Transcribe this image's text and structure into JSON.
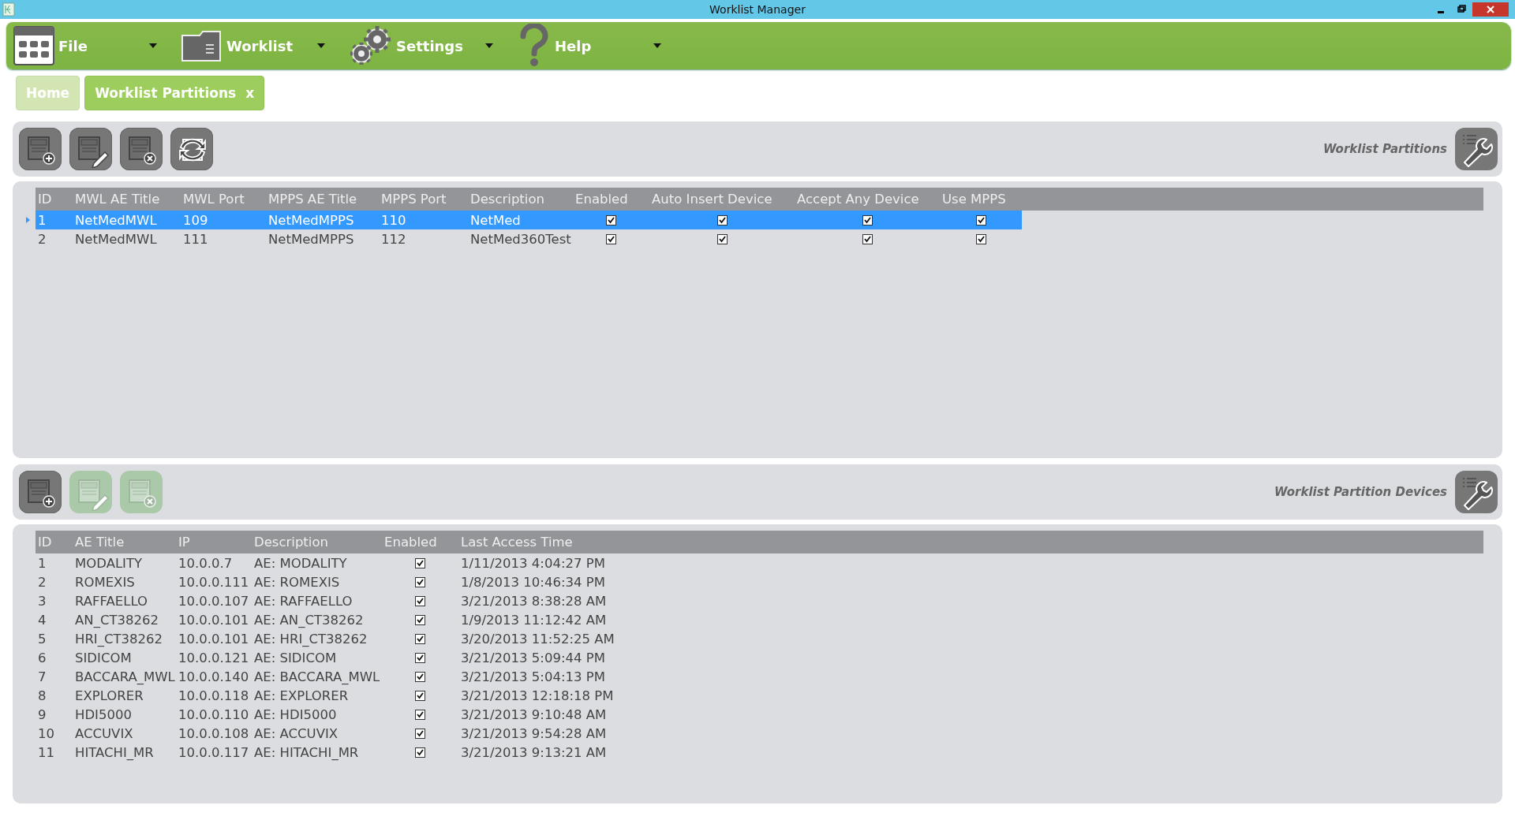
{
  "window": {
    "title": "Worklist Manager"
  },
  "menu": [
    {
      "label": "File",
      "kind": "file"
    },
    {
      "label": "Worklist",
      "kind": "worklist"
    },
    {
      "label": "Settings",
      "kind": "settings"
    },
    {
      "label": "Help",
      "kind": "help"
    }
  ],
  "tabs": [
    {
      "label": "Home",
      "selected": false
    },
    {
      "label": "Worklist Partitions",
      "selected": true,
      "close_label": "x"
    }
  ],
  "sections": [
    {
      "title": "Worklist Partitions",
      "toolbar": [
        {
          "kind": "add",
          "disabled": false
        },
        {
          "kind": "edit",
          "disabled": false
        },
        {
          "kind": "delete",
          "disabled": false
        },
        {
          "kind": "refresh",
          "disabled": false
        }
      ],
      "columns": [
        {
          "label": "ID",
          "kind": "text"
        },
        {
          "label": "MWL AE Title",
          "kind": "text"
        },
        {
          "label": "MWL Port",
          "kind": "text"
        },
        {
          "label": "MPPS AE Title",
          "kind": "text"
        },
        {
          "label": "MPPS Port",
          "kind": "text"
        },
        {
          "label": "Description",
          "kind": "text"
        },
        {
          "label": "Enabled",
          "kind": "check"
        },
        {
          "label": "Auto Insert Device",
          "kind": "check"
        },
        {
          "label": "Accept Any Device",
          "kind": "check"
        },
        {
          "label": "Use MPPS",
          "kind": "check"
        }
      ],
      "rows": [
        {
          "selected": true,
          "cells": [
            "1",
            "NetMedMWL",
            "109",
            "NetMedMPPS",
            "110",
            "NetMed",
            true,
            true,
            true,
            true
          ]
        },
        {
          "selected": false,
          "cells": [
            "2",
            "NetMedMWL",
            "111",
            "NetMedMPPS",
            "112",
            "NetMed360Test",
            true,
            true,
            true,
            true
          ]
        }
      ]
    },
    {
      "title": "Worklist Partition Devices",
      "toolbar": [
        {
          "kind": "add",
          "disabled": false
        },
        {
          "kind": "edit",
          "disabled": true
        },
        {
          "kind": "delete",
          "disabled": true
        }
      ],
      "columns": [
        {
          "label": "ID",
          "kind": "text"
        },
        {
          "label": "AE Title",
          "kind": "text"
        },
        {
          "label": "IP",
          "kind": "text"
        },
        {
          "label": "Description",
          "kind": "text"
        },
        {
          "label": "Enabled",
          "kind": "check"
        },
        {
          "label": "Last Access Time",
          "kind": "text"
        }
      ],
      "rows": [
        {
          "selected": false,
          "cells": [
            "1",
            "MODALITY",
            "10.0.0.7",
            "AE: MODALITY",
            true,
            "1/11/2013 4:04:27 PM"
          ]
        },
        {
          "selected": false,
          "cells": [
            "2",
            "ROMEXIS",
            "10.0.0.111",
            "AE: ROMEXIS",
            true,
            "1/8/2013 10:46:34 PM"
          ]
        },
        {
          "selected": false,
          "cells": [
            "3",
            "RAFFAELLO",
            "10.0.0.107",
            "AE: RAFFAELLO",
            true,
            "3/21/2013 8:38:28 AM"
          ]
        },
        {
          "selected": false,
          "cells": [
            "4",
            "AN_CT38262",
            "10.0.0.101",
            "AE: AN_CT38262",
            true,
            "1/9/2013 11:12:42 AM"
          ]
        },
        {
          "selected": false,
          "cells": [
            "5",
            "HRI_CT38262",
            "10.0.0.101",
            "AE: HRI_CT38262",
            true,
            "3/20/2013 11:52:25 AM"
          ]
        },
        {
          "selected": false,
          "cells": [
            "6",
            "SIDICOM",
            "10.0.0.121",
            "AE: SIDICOM",
            true,
            "3/21/2013 5:09:44 PM"
          ]
        },
        {
          "selected": false,
          "cells": [
            "7",
            "BACCARA_MWL",
            "10.0.0.140",
            "AE: BACCARA_MWL",
            true,
            "3/21/2013 5:04:13 PM"
          ]
        },
        {
          "selected": false,
          "cells": [
            "8",
            "EXPLORER",
            "10.0.0.118",
            "AE: EXPLORER",
            true,
            "3/21/2013 12:18:18 PM"
          ]
        },
        {
          "selected": false,
          "cells": [
            "9",
            "HDI5000",
            "10.0.0.110",
            "AE: HDI5000",
            true,
            "3/21/2013 9:10:48 AM"
          ]
        },
        {
          "selected": false,
          "cells": [
            "10",
            "ACCUVIX",
            "10.0.0.108",
            "AE: ACCUVIX",
            true,
            "3/21/2013 9:54:28 AM"
          ]
        },
        {
          "selected": false,
          "cells": [
            "11",
            "HITACHI_MR",
            "10.0.0.117",
            "AE: HITACHI_MR",
            true,
            "3/21/2013 9:13:21 AM"
          ]
        }
      ]
    }
  ]
}
